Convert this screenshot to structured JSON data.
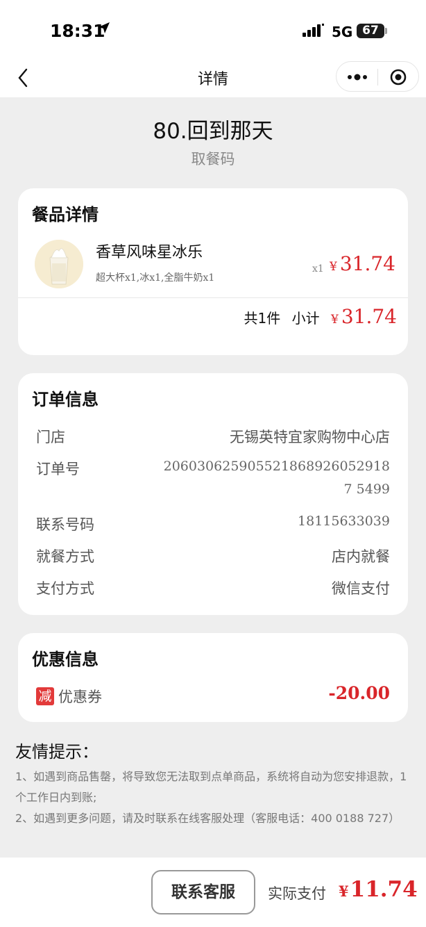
{
  "status_bar": {
    "time": "18:31",
    "network": "5G",
    "battery": "67"
  },
  "nav": {
    "title": "详情"
  },
  "pickup": {
    "number": "80.回到那天",
    "label": "取餐码"
  },
  "food_card": {
    "title": "餐品详情",
    "item": {
      "name": "香草风味星冰乐",
      "options": "超大杯x1,冰x1,全脂牛奶x1",
      "qty": "x1",
      "currency": "¥",
      "price": "31.74"
    },
    "summary": {
      "count": "共1件",
      "subtotal_label": "小计",
      "currency": "¥",
      "subtotal": "31.74"
    }
  },
  "order_card": {
    "title": "订单信息",
    "store_label": "门店",
    "store_value": "无锡英特宜家购物中心店",
    "order_no_label": "订单号",
    "order_no_value": "2060306259055218689260529187 5499",
    "phone_label": "联系号码",
    "phone_value": "18115633039",
    "dining_label": "就餐方式",
    "dining_value": "店内就餐",
    "payment_label": "支付方式",
    "payment_value": "微信支付"
  },
  "discount_card": {
    "title": "优惠信息",
    "badge": "减",
    "label": "优惠券",
    "amount": "-20.00"
  },
  "tips": {
    "title": "友情提示：",
    "line1": "1、如遇到商品售罄，将导致您无法取到点单商品，系统将自动为您安排退款，1个工作日内到账;",
    "line2": "2、如遇到更多问题，请及时联系在线客服处理（客服电话：400 0188 727）"
  },
  "bottom": {
    "contact_button": "联系客服",
    "paid_label": "实际支付",
    "currency": "¥",
    "paid_amount": "11.74"
  },
  "colors": {
    "price_red": "#d9252a",
    "background": "#eeeeee",
    "card": "#ffffff"
  },
  "icons": [
    "location-arrow-icon",
    "signal-icon",
    "back-icon",
    "more-icon",
    "close-target-icon"
  ]
}
